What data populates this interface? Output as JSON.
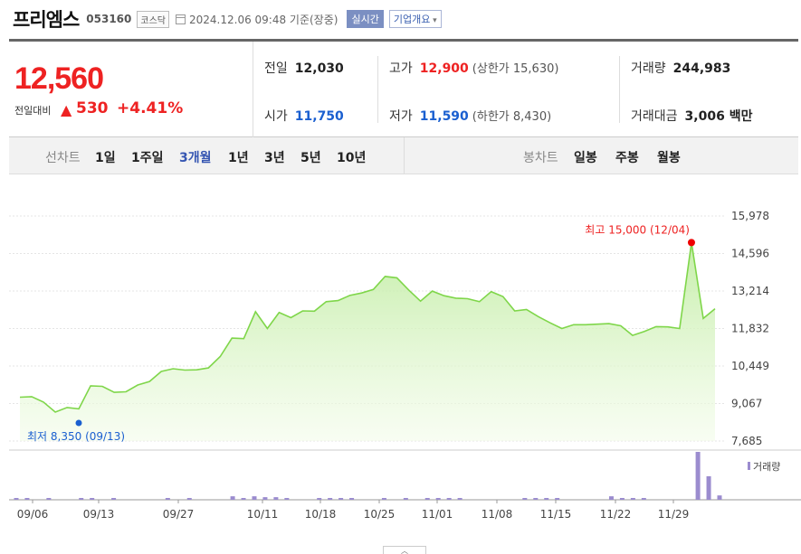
{
  "header": {
    "company": "프리엠스",
    "code": "053160",
    "market": "코스닥",
    "date": "2024.12.06 09:48  기준(장중)",
    "live_label": "실시간",
    "overview_label": "기업개요"
  },
  "quote": {
    "price": "12,560",
    "change_label": "전일대비",
    "change_icon": "up-triangle-icon",
    "change": "530",
    "change_pct": "+4.41%"
  },
  "stats": {
    "prev_label": "전일",
    "prev": "12,030",
    "high_label": "고가",
    "high": "12,900",
    "upper_limit": "(상한가 15,630)",
    "volume_label": "거래량",
    "volume": "244,983",
    "open_label": "시가",
    "open": "11,750",
    "low_label": "저가",
    "low": "11,590",
    "lower_limit": "(하한가 8,430)",
    "amount_label": "거래대금",
    "amount": "3,006 백만"
  },
  "periods": {
    "line_label": "선차트",
    "line_items": [
      "1일",
      "1주일",
      "3개월",
      "1년",
      "3년",
      "5년",
      "10년"
    ],
    "active": "3개월",
    "candle_label": "봉차트",
    "candle_items": [
      "일봉",
      "주봉",
      "월봉"
    ]
  },
  "colors": {
    "up": "#ee2222",
    "down": "#1a5fd0",
    "line": "#7fd64a",
    "volume": "#9b8ccf"
  },
  "chart_data": {
    "type": "area",
    "yticks": [
      "15,978",
      "14,596",
      "13,214",
      "11,832",
      "10,449",
      "9,067",
      "7,685"
    ],
    "ylim": [
      7685,
      15978
    ],
    "xticks": [
      "09/06",
      "09/13",
      "09/27",
      "10/11",
      "10/18",
      "10/25",
      "11/01",
      "11/08",
      "11/15",
      "11/22",
      "11/29"
    ],
    "high_annotation": "최고 15,000 (12/04)",
    "low_annotation": "최저 8,350 (09/13)",
    "high": 15000,
    "low": 8350,
    "volume_legend": "거래량",
    "prices": [
      9300,
      9320,
      9120,
      8750,
      8920,
      8870,
      9720,
      9700,
      9480,
      9500,
      9750,
      9880,
      10250,
      10350,
      10300,
      10310,
      10380,
      10800,
      11480,
      11460,
      12450,
      11830,
      12420,
      12230,
      12480,
      12470,
      12820,
      12860,
      13050,
      13140,
      13270,
      13750,
      13700,
      13250,
      12840,
      13210,
      13040,
      12950,
      12930,
      12820,
      13190,
      13010,
      12480,
      12530,
      12270,
      12040,
      11830,
      11970,
      11970,
      11990,
      12010,
      11930,
      11580,
      11720,
      11900,
      11890,
      11830,
      15000,
      12200,
      12560
    ],
    "volumes": [
      2,
      2,
      0,
      2,
      0,
      0,
      1,
      2,
      0,
      2,
      0,
      0,
      0,
      0,
      2,
      0,
      2,
      0,
      0,
      0,
      4,
      2,
      4,
      3,
      3,
      2,
      0,
      0,
      1,
      2,
      2,
      2,
      0,
      0,
      2,
      0,
      2,
      0,
      2,
      2,
      2,
      2,
      0,
      0,
      0,
      0,
      0,
      2,
      2,
      2,
      2,
      0,
      0,
      0,
      0,
      4,
      2,
      2,
      1,
      0,
      0,
      0,
      0,
      55,
      27,
      5
    ]
  }
}
